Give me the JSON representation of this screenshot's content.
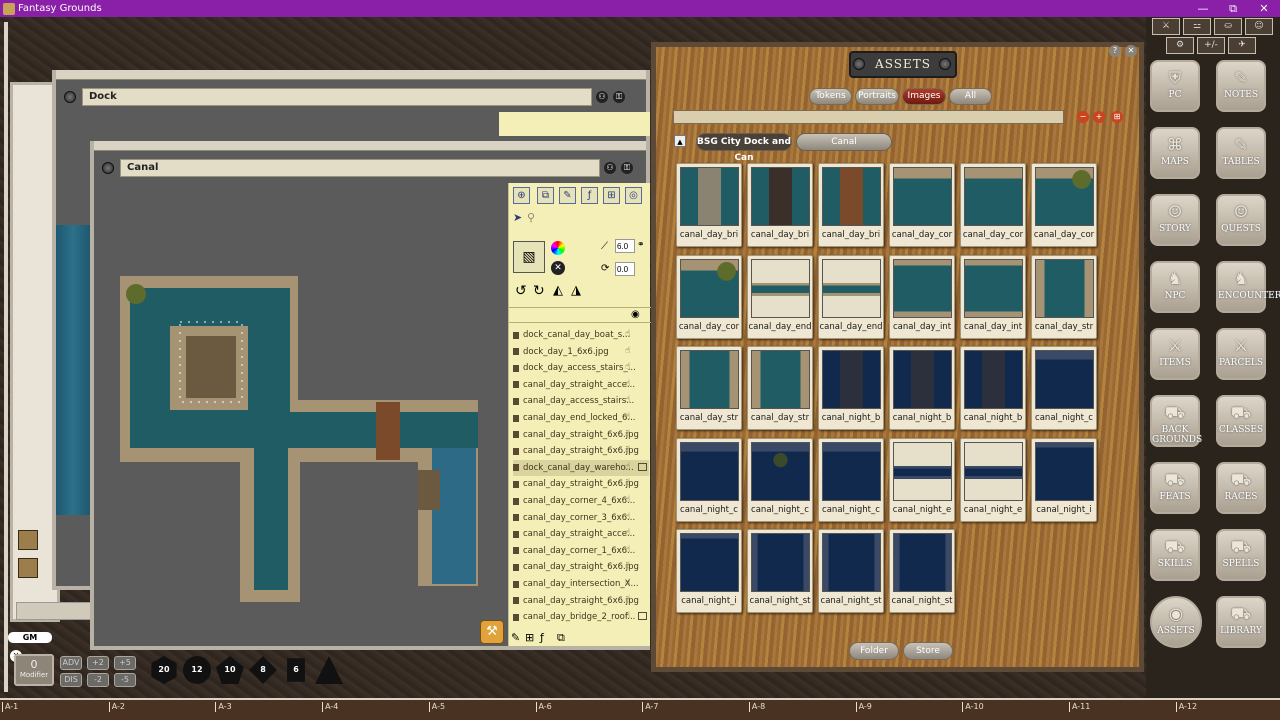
{
  "window": {
    "title": "Fantasy Grounds",
    "minimize": "—",
    "restore": "⧉",
    "close": "✕"
  },
  "dock_window": {
    "name": "Dock"
  },
  "canal_window": {
    "name": "Canal"
  },
  "image_tools": {
    "grid_size": "6.0",
    "rotation": "0.0",
    "files": [
      {
        "name": "dock_canal_day_boat_s...",
        "grid": false,
        "selected": false
      },
      {
        "name": "dock_day_1_6x6.jpg",
        "grid": false,
        "selected": false
      },
      {
        "name": "dock_day_access_stairs_...",
        "grid": false,
        "selected": false
      },
      {
        "name": "canal_day_straight_acce...",
        "grid": false,
        "selected": false
      },
      {
        "name": "canal_day_access_stairs...",
        "grid": false,
        "selected": false
      },
      {
        "name": "canal_day_end_locked_6...",
        "grid": false,
        "selected": false
      },
      {
        "name": "canal_day_straight_6x6.jpg",
        "grid": false,
        "selected": false
      },
      {
        "name": "canal_day_straight_6x6.jpg",
        "grid": false,
        "selected": false
      },
      {
        "name": "dock_canal_day_wareho...",
        "grid": true,
        "selected": true
      },
      {
        "name": "canal_day_straight_6x6.jpg",
        "grid": false,
        "selected": false
      },
      {
        "name": "canal_day_corner_4_6x6...",
        "grid": false,
        "selected": false
      },
      {
        "name": "canal_day_corner_3_6x6...",
        "grid": false,
        "selected": false
      },
      {
        "name": "canal_day_straight_acce...",
        "grid": false,
        "selected": false
      },
      {
        "name": "canal_day_corner_1_6x6...",
        "grid": false,
        "selected": false
      },
      {
        "name": "canal_day_straight_6x6.jpg",
        "grid": false,
        "selected": false
      },
      {
        "name": "canal_day_intersection_X...",
        "grid": false,
        "selected": false
      },
      {
        "name": "canal_day_straight_6x6.jpg",
        "grid": false,
        "selected": false
      },
      {
        "name": "canal_day_bridge_2_roof...",
        "grid": true,
        "selected": false
      }
    ]
  },
  "assets": {
    "title": "ASSETS",
    "tabs": [
      "Tokens",
      "Portraits",
      "Images",
      "All"
    ],
    "active_tab": "Images",
    "breadcrumb": [
      "BSG City Dock and Can",
      "Canal"
    ],
    "items": [
      {
        "label": "canal_day_bri",
        "kind": "day-bridge-stone"
      },
      {
        "label": "canal_day_bri",
        "kind": "day-bridge-dark"
      },
      {
        "label": "canal_day_bri",
        "kind": "day-bridge-wood"
      },
      {
        "label": "canal_day_cor",
        "kind": "day-corner"
      },
      {
        "label": "canal_day_cor",
        "kind": "day-corner"
      },
      {
        "label": "canal_day_cor",
        "kind": "day-corner-tree"
      },
      {
        "label": "canal_day_cor",
        "kind": "day-corner-tree"
      },
      {
        "label": "canal_day_end",
        "kind": "day-end"
      },
      {
        "label": "canal_day_end",
        "kind": "day-end"
      },
      {
        "label": "canal_day_int",
        "kind": "day-int"
      },
      {
        "label": "canal_day_int",
        "kind": "day-int"
      },
      {
        "label": "canal_day_str",
        "kind": "day-str"
      },
      {
        "label": "canal_day_str",
        "kind": "day-str"
      },
      {
        "label": "canal_day_str",
        "kind": "day-str"
      },
      {
        "label": "canal_night_b",
        "kind": "night-bridge"
      },
      {
        "label": "canal_night_b",
        "kind": "night-bridge"
      },
      {
        "label": "canal_night_b",
        "kind": "night-bridge"
      },
      {
        "label": "canal_night_c",
        "kind": "night-corner"
      },
      {
        "label": "canal_night_c",
        "kind": "night-corner"
      },
      {
        "label": "canal_night_c",
        "kind": "night-corner-tree"
      },
      {
        "label": "canal_night_c",
        "kind": "night-corner"
      },
      {
        "label": "canal_night_e",
        "kind": "night-end"
      },
      {
        "label": "canal_night_e",
        "kind": "night-end"
      },
      {
        "label": "canal_night_i",
        "kind": "night-int"
      },
      {
        "label": "canal_night_i",
        "kind": "night-int"
      },
      {
        "label": "canal_night_st",
        "kind": "night-str"
      },
      {
        "label": "canal_night_st",
        "kind": "night-str"
      },
      {
        "label": "canal_night_st",
        "kind": "night-str"
      }
    ],
    "folder_button": "Folder",
    "store_button": "Store"
  },
  "sidebar": {
    "top_icons": [
      "⚔",
      "⚍",
      "⛀",
      "☺",
      "⚙",
      "+/-",
      "✈"
    ],
    "buttons": [
      {
        "label": "PC",
        "icon": "⛨"
      },
      {
        "label": "NOTES",
        "icon": "✎"
      },
      {
        "label": "MAPS",
        "icon": "⌘"
      },
      {
        "label": "TABLES",
        "icon": "✎"
      },
      {
        "label": "STORY",
        "icon": "☺"
      },
      {
        "label": "QUESTS",
        "icon": "☺"
      },
      {
        "label": "NPC",
        "icon": "♞"
      },
      {
        "label": "ENCOUNTERS",
        "icon": "♞"
      },
      {
        "label": "ITEMS",
        "icon": "⚔"
      },
      {
        "label": "PARCELS",
        "icon": "⚔"
      },
      {
        "label": "BACK GROUNDS",
        "icon": "⛟"
      },
      {
        "label": "CLASSES",
        "icon": "⛟"
      },
      {
        "label": "FEATS",
        "icon": "⛟"
      },
      {
        "label": "RACES",
        "icon": "⛟"
      },
      {
        "label": "SKILLS",
        "icon": "⛟"
      },
      {
        "label": "SPELLS",
        "icon": "⛟"
      },
      {
        "label": "ASSETS",
        "icon": "◉"
      },
      {
        "label": "LIBRARY",
        "icon": "⛟"
      }
    ]
  },
  "bottom": {
    "gm_label": "GM",
    "modifier_value": "0",
    "modifier_label": "Modifier",
    "adv": "ADV",
    "dis": "DIS",
    "mods": [
      "+2",
      "+5",
      "-2",
      "-5"
    ],
    "dice": [
      "20",
      "12",
      "10",
      "8",
      "6",
      ""
    ],
    "ruler": [
      "A-1",
      "A-2",
      "A-3",
      "A-4",
      "A-5",
      "A-6",
      "A-7",
      "A-8",
      "A-9",
      "A-10",
      "A-11",
      "A-12"
    ]
  },
  "colors": {
    "titlebar": "#8a1fa8",
    "active_tab": "#b13b2a",
    "canvas": "#5b5b5b",
    "water_day": "#1f5c64",
    "water_night": "#12294e"
  }
}
